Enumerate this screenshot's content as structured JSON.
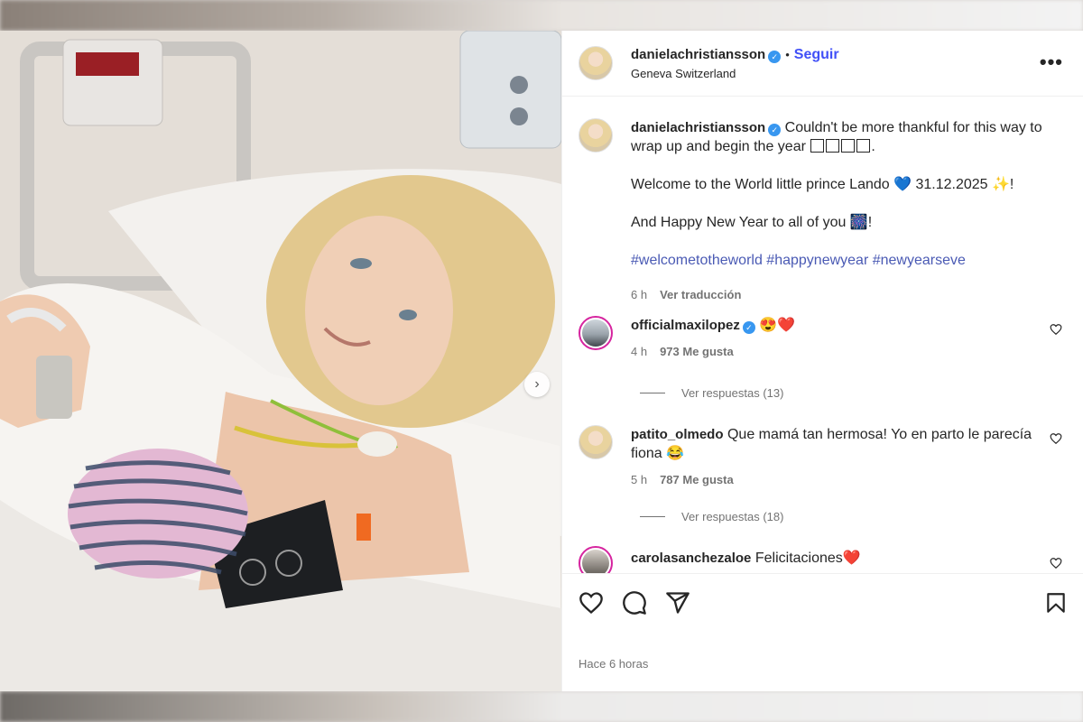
{
  "post": {
    "author": "danielachristiansson",
    "follow_label": "Seguir",
    "location": "Geneva Switzerland",
    "more_label": "•••"
  },
  "caption": {
    "author": "danielachristiansson",
    "line1": "Couldn't be more thankful for this way to wrap up and begin the year ",
    "line2": "Welcome to the World little prince Lando 💙 31.12.2025 ✨!",
    "line3": "And Happy New Year to all of you 🎆!",
    "hashtags": "#welcometotheworld #happynewyear #newyearseve",
    "time": "6 h",
    "translate_label": "Ver traducción"
  },
  "comments": [
    {
      "author": "officialmaxilopez",
      "text": "😍❤️",
      "time": "4 h",
      "likes": "973 Me gusta",
      "replies": "Ver respuestas (13)"
    },
    {
      "author": "patito_olmedo",
      "text": "Que mamá tan hermosa! Yo en parto le parecía fiona 😂",
      "time": "5 h",
      "likes": "787 Me gusta",
      "replies": "Ver respuestas (18)"
    },
    {
      "author": "carolasanchezaloe",
      "text": "Felicitaciones❤️"
    }
  ],
  "footer": {
    "timestamp": "Hace 6 horas"
  },
  "icons": {
    "verified": "verified-badge-icon",
    "like": "heart-icon",
    "comment": "comment-icon",
    "share": "share-icon",
    "save": "bookmark-icon",
    "next": "chevron-right-icon"
  },
  "colors": {
    "follow": "#4150f7",
    "hashtag": "#4a5ab4",
    "verified": "#3897f0",
    "muted": "#737373"
  }
}
